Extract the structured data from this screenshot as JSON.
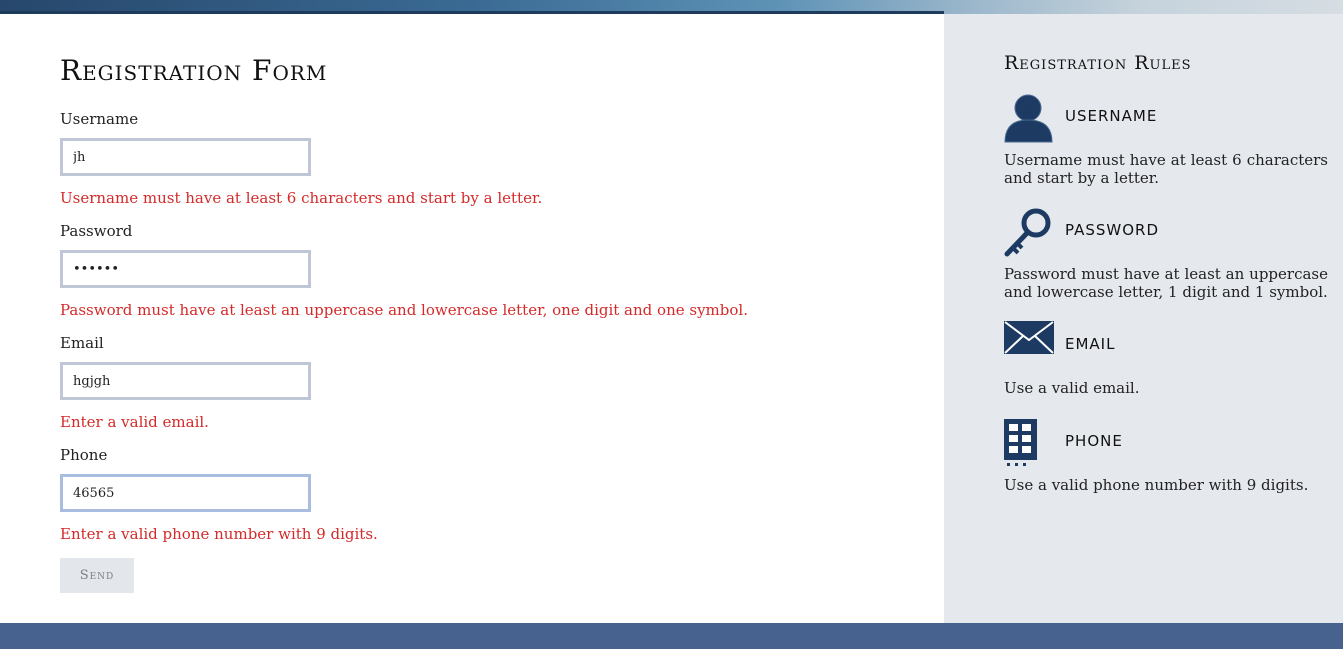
{
  "form": {
    "title": "Registration Form",
    "fields": [
      {
        "label": "Username",
        "value": "jh",
        "error": "Username must have at least 6 characters and start by a letter."
      },
      {
        "label": "Password",
        "value": "••••••",
        "error": "Password must have at least an uppercase and lowercase letter, one digit and one symbol."
      },
      {
        "label": "Email",
        "value": "hgjgh",
        "error": "Enter a valid email."
      },
      {
        "label": "Phone",
        "value": "46565",
        "error": "Enter a valid phone number with 9 digits."
      }
    ],
    "send_label": "Send"
  },
  "rules": {
    "title": "Registration Rules",
    "items": [
      {
        "heading": "USERNAME",
        "text": "Username must have at least 6 characters and start by a letter.",
        "icon": "user-icon"
      },
      {
        "heading": "PASSWORD",
        "text": "Password must have at least an uppercase and lowercase letter, 1 digit and 1 symbol.",
        "icon": "key-icon"
      },
      {
        "heading": "EMAIL",
        "text": "Use a valid email.",
        "icon": "envelope-icon"
      },
      {
        "heading": "PHONE",
        "text": "Use a valid phone number with 9 digits.",
        "icon": "phone-icon"
      }
    ]
  },
  "colors": {
    "error": "#d42a2a",
    "icon": "#1d3a63",
    "sidebar_bg": "#e5e8ed",
    "footer_bg": "#47628f"
  }
}
